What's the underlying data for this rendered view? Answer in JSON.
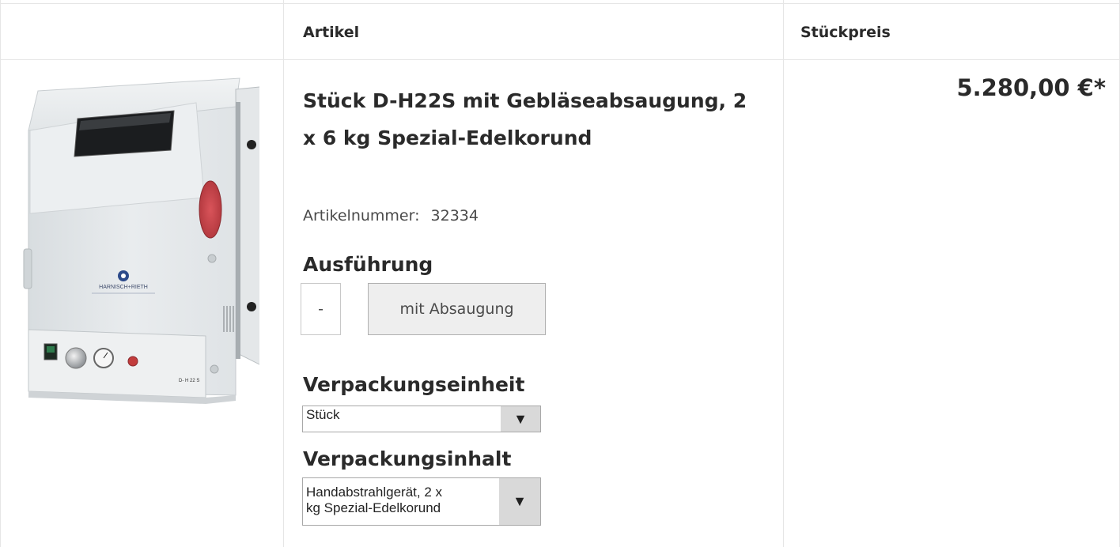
{
  "table": {
    "headers": {
      "article": "Artikel",
      "unit_price": "Stückpreis"
    }
  },
  "product": {
    "image_alt": "Sandstrahlgerät D-H 22 S",
    "image_brand_text": "HARNISCH+RIETH",
    "image_model_text": "D- H 22 S",
    "title": "Stück D-H22S mit Gebläseabsaugung, 2 x 6 kg Spezial-Edelkorund",
    "article_number_label": "Artikelnummer:",
    "article_number": "32334",
    "price": "5.280,00 €*"
  },
  "variants": {
    "execution": {
      "heading": "Ausführung",
      "options": [
        "-",
        "mit Absaugung"
      ],
      "selected": "mit Absaugung"
    },
    "packaging_unit": {
      "heading": "Verpackungseinheit",
      "selected": "Stück"
    },
    "packaging_content": {
      "heading": "Verpackungsinhalt",
      "selected_line1": "Handabstrahlgerät, 2 x",
      "selected_line2": "kg Spezial-Edelkorund"
    }
  },
  "colors": {
    "border": "#e6e6e6",
    "selected_bg": "#eeeeee",
    "dropdown_arrow_bg": "#d9d9d9"
  },
  "icons": {
    "dropdown": "triangle-down-icon"
  }
}
